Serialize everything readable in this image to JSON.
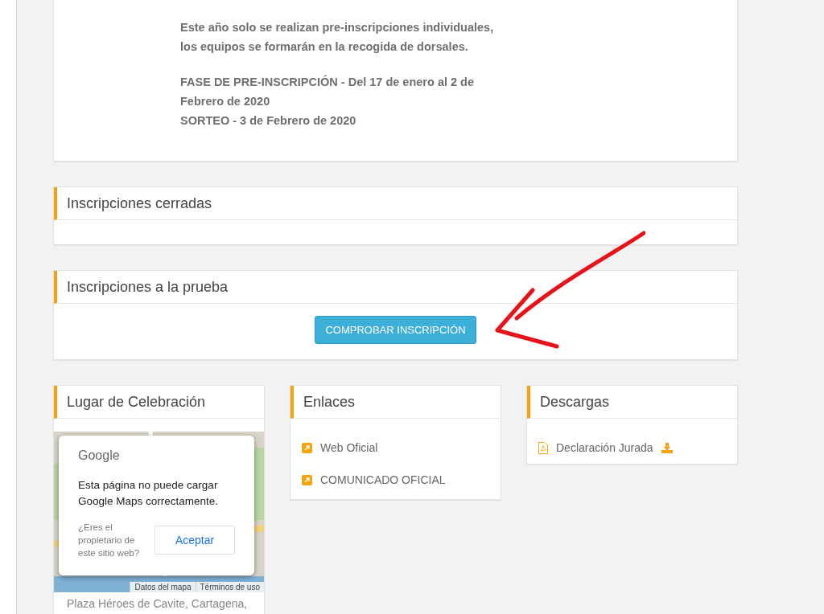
{
  "notice": {
    "paragraphs": [
      "Este año solo se realizan pre-inscripciones individuales, los equipos se formarán en la recogida de dorsales.",
      "FASE DE PRE-INSCRIPCIÓN - Del 17 de enero al 2 de Febrero de 2020\nSORTEO - 3 de Febrero de 2020"
    ]
  },
  "closed_panel": {
    "title": "Inscripciones cerradas"
  },
  "registration_panel": {
    "title": "Inscripciones a la prueba",
    "button": "COMPROBAR INSCRIPCIÓN"
  },
  "venue_panel": {
    "title": "Lugar de Celebración",
    "map": {
      "kind": "picture",
      "dialog": {
        "brand": "Google",
        "message": "Esta página no puede cargar Google Maps correctamente.",
        "question": "¿Eres el propietario de este sitio web?",
        "button": "Aceptar"
      },
      "attribution": [
        "Datos del mapa",
        "Términos de uso"
      ]
    },
    "address": "Plaza Héroes de Cavite, Cartagena,"
  },
  "links_panel": {
    "title": "Enlaces",
    "links": [
      {
        "label": "Web Oficial"
      },
      {
        "label": "COMUNICADO OFICIAL"
      }
    ]
  },
  "downloads_panel": {
    "title": "Descargas",
    "files": [
      {
        "label": "Declaración Jurada"
      }
    ]
  }
}
